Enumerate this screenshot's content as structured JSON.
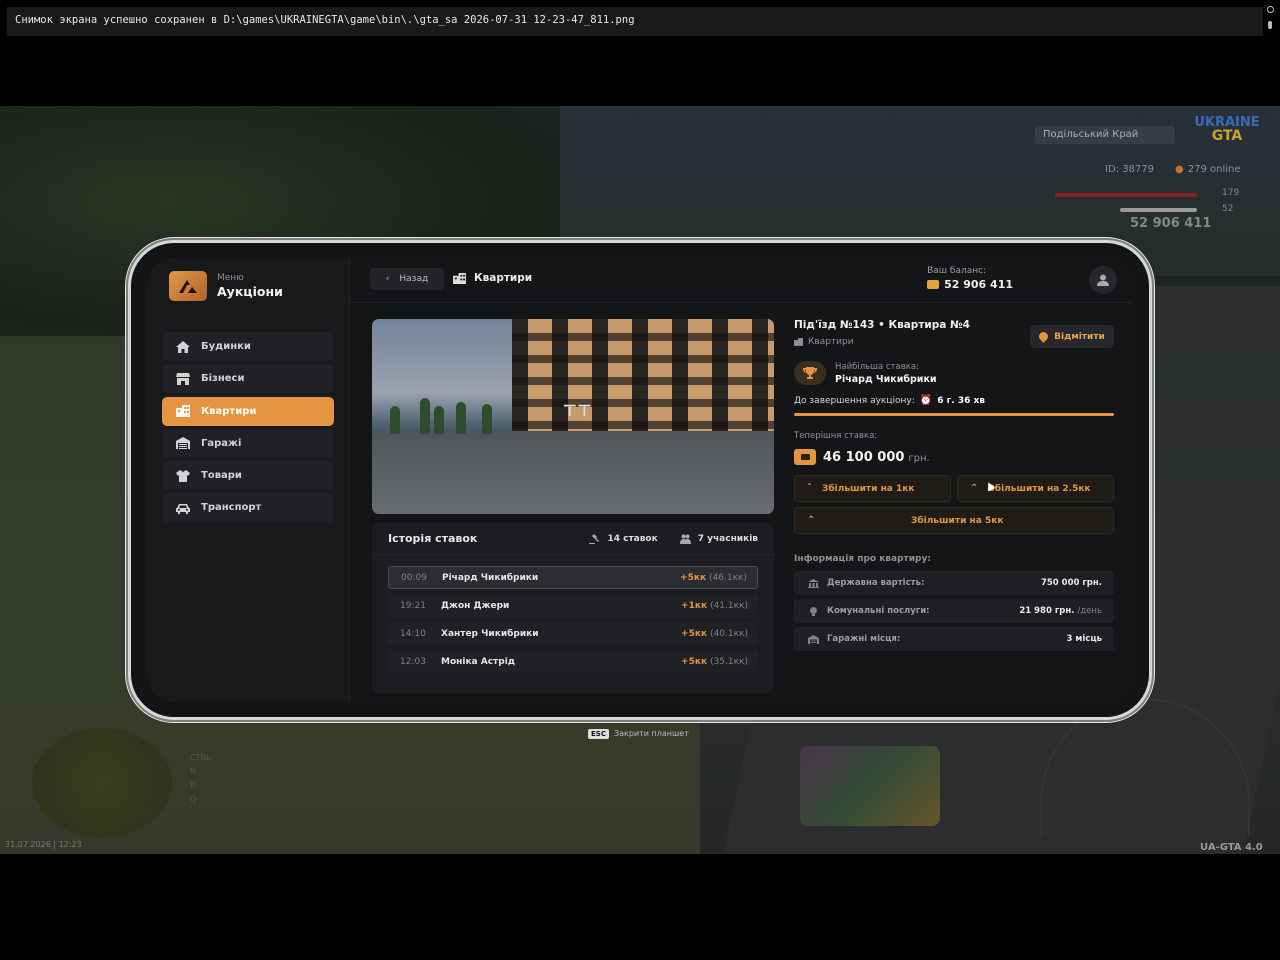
{
  "notification": {
    "text": "Снимок экрана успешно сохранен в D:\\games\\UKRAINEGTA\\game\\bin\\.\\gta_sa 2026-07-31 12-23-47_811.png"
  },
  "hud": {
    "region": "Подільський Край",
    "logo_top": "UKRAINE",
    "logo_bottom": "GTA",
    "player_id": "ID: 38779",
    "online": "279 online",
    "health": "179",
    "armor": "52",
    "money": "52 906 411",
    "date": "31.07.2026 | 12:23",
    "version": "UA-GTA 4.0",
    "esc_key": "ESC",
    "esc_text": "Закрити планшет",
    "accent": "#e59542"
  },
  "sidebar": {
    "subtitle": "Меню",
    "title": "Аукціони",
    "items": [
      {
        "label": "Будинки",
        "icon": "home-icon",
        "active": false
      },
      {
        "label": "Бізнеси",
        "icon": "store-icon",
        "active": false
      },
      {
        "label": "Квартири",
        "icon": "apartment-icon",
        "active": true
      },
      {
        "label": "Гаражі",
        "icon": "garage-icon",
        "active": false
      },
      {
        "label": "Товари",
        "icon": "shirt-icon",
        "active": false
      },
      {
        "label": "Транспорт",
        "icon": "car-icon",
        "active": false
      }
    ]
  },
  "topbar": {
    "back_label": "Назад",
    "section": "Квартири",
    "balance_label": "Ваш баланс:",
    "balance_value": "52 906 411"
  },
  "listing": {
    "title": "Під'їзд №143 • Квартира №4",
    "type": "Квартири",
    "favorite_label": "Відмітити",
    "top_bid_label": "Найбільша ставка:",
    "top_bid_name": "Річард Чикибрики",
    "until_label": "До завершення аукціону:",
    "until_value": "6 г. 36 хв",
    "progress_percent": 100,
    "current_label": "Теперішня ставка:",
    "current_value": "46 100 000",
    "current_currency": "грн.",
    "inc_1": "Збільшити на 1кк",
    "inc_2": "Збільшити на 2.5кк",
    "inc_3": "Збільшити на 5кк",
    "info_title": "Інформація про квартиру:",
    "info": [
      {
        "key": "Державна вартість:",
        "value": "750 000 грн.",
        "suffix": ""
      },
      {
        "key": "Комунальні послуги:",
        "value": "21 980 грн.",
        "suffix": "/день"
      },
      {
        "key": "Гаражні місця:",
        "value": "3 місць",
        "suffix": ""
      }
    ]
  },
  "history": {
    "title": "Історія ставок",
    "bids_count": "14 ставок",
    "participants": "7 учасників",
    "rows": [
      {
        "time": "00:09",
        "name": "Річард Чикибрики",
        "plus": "+5кк",
        "total": "(46.1кк)"
      },
      {
        "time": "19:21",
        "name": "Джон Джери",
        "plus": "+1кк",
        "total": "(41.1кк)"
      },
      {
        "time": "14:10",
        "name": "Хантер Чикибрики",
        "plus": "+5кк",
        "total": "(40.1кк)"
      },
      {
        "time": "12:03",
        "name": "Моніка Астрід",
        "plus": "+5кк",
        "total": "(35.1кк)"
      }
    ]
  }
}
